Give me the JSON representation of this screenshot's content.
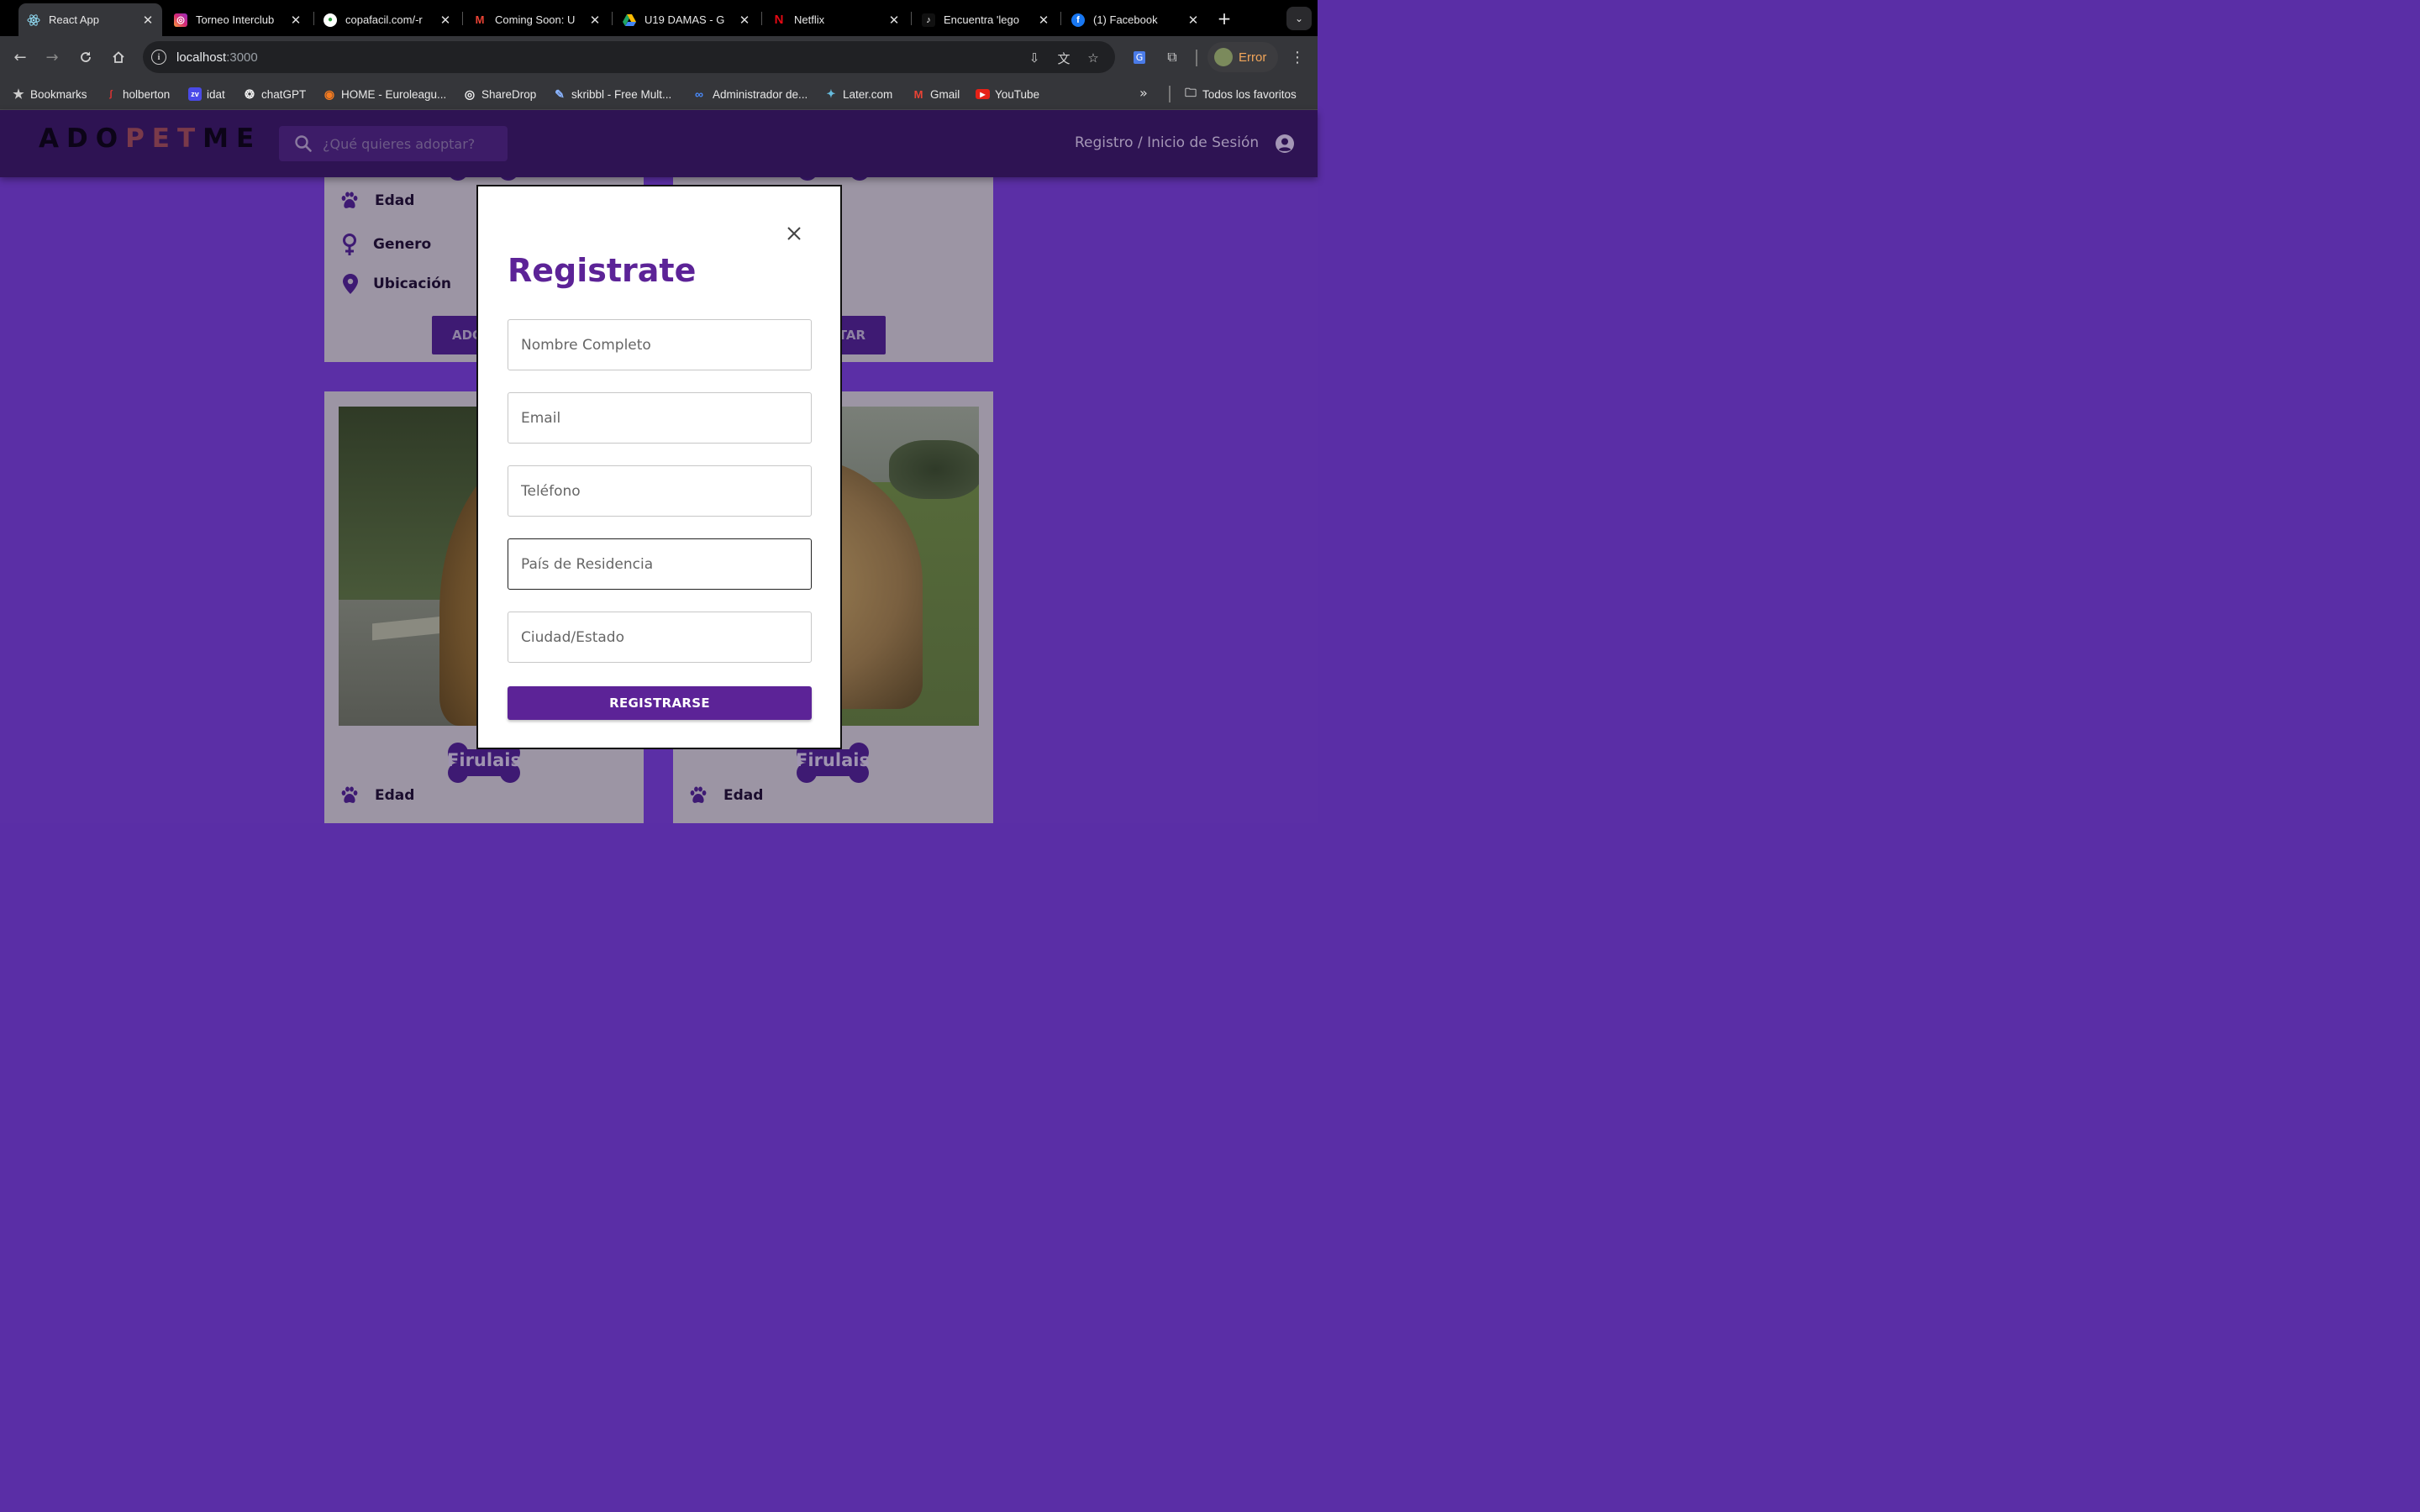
{
  "browser": {
    "tabs": [
      {
        "title": "React App",
        "favicon": "react-icon",
        "active": true
      },
      {
        "title": "Torneo Interclub",
        "favicon": "instagram-icon"
      },
      {
        "title": "copafacil.com/-r",
        "favicon": "copafacil-icon"
      },
      {
        "title": "Coming Soon: U",
        "favicon": "gmail-icon"
      },
      {
        "title": "U19 DAMAS - G",
        "favicon": "google-drive-icon"
      },
      {
        "title": "Netflix",
        "favicon": "netflix-icon"
      },
      {
        "title": "Encuentra 'lego",
        "favicon": "tiktok-icon"
      },
      {
        "title": "(1) Facebook",
        "favicon": "facebook-icon"
      }
    ],
    "new_tab": "+",
    "url_host": "localhost",
    "url_port": ":3000",
    "profile_label": "Error",
    "bookmarks": [
      {
        "label": "Bookmarks",
        "icon": "star-icon"
      },
      {
        "label": "holberton",
        "icon": "holberton-icon"
      },
      {
        "label": "idat",
        "icon": "idat-icon"
      },
      {
        "label": "chatGPT",
        "icon": "openai-icon"
      },
      {
        "label": "HOME - Euroleagu...",
        "icon": "euroleague-icon"
      },
      {
        "label": "ShareDrop",
        "icon": "sharedrop-icon"
      },
      {
        "label": "skribbl - Free Mult...",
        "icon": "skribbl-icon"
      },
      {
        "label": "Administrador de...",
        "icon": "meta-icon"
      },
      {
        "label": "Later.com",
        "icon": "later-icon"
      },
      {
        "label": "Gmail",
        "icon": "gmail-icon"
      },
      {
        "label": "YouTube",
        "icon": "youtube-icon"
      }
    ],
    "all_bookmarks": "Todos los favoritos"
  },
  "app": {
    "logo_left": "ADO",
    "logo_mid": "PET",
    "logo_right": "ME",
    "search_placeholder": "¿Qué quieres adoptar?",
    "auth_link": "Registro / Inicio de Sesión"
  },
  "cards": {
    "attr_age": "Edad",
    "attr_gender": "Genero",
    "attr_location": "Ubicación",
    "adopt_left_partial": "ADO",
    "adopt_right_partial": "TAR",
    "pet_name_1": "Firulais",
    "pet_name_2": "Firulais"
  },
  "modal": {
    "title": "Registrate",
    "fields": {
      "name": "Nombre Completo",
      "email": "Email",
      "phone": "Teléfono",
      "country": "País de Residencia",
      "city": "Ciudad/Estado"
    },
    "submit_label": "REGISTRARSE"
  },
  "colors": {
    "brand_purple": "#5c2397",
    "page_bg": "#5b2fa6",
    "appbar_bg": "#2e1353"
  }
}
